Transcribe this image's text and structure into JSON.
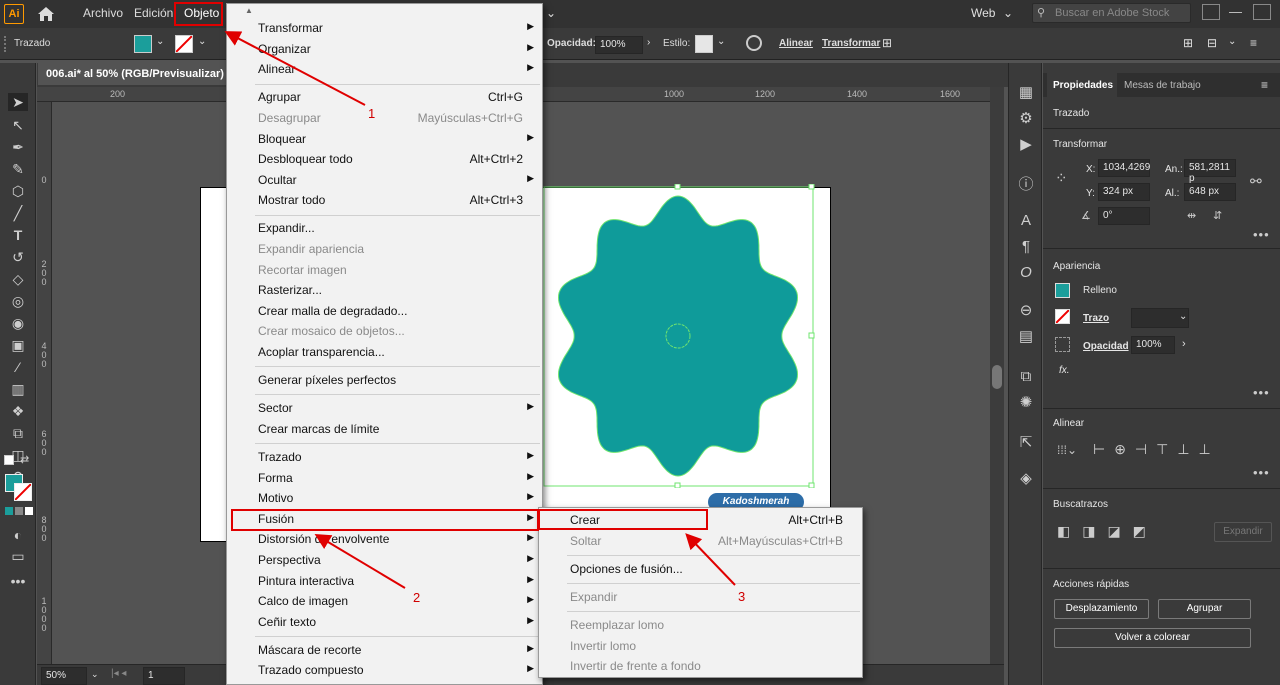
{
  "menubar": {
    "app_logo": "Ai",
    "menus": [
      "Archivo",
      "Edición",
      "Objeto"
    ],
    "workspace": "Web",
    "search_placeholder": "Buscar en Adobe Stock"
  },
  "control_bar": {
    "selection": "Trazado",
    "fill_color": "#1b9e9b",
    "opacity_label": "Opacidad:",
    "opacity_value": "100%",
    "style_label": "Estilo:",
    "align_label": "Alinear",
    "transform_label": "Transformar"
  },
  "document": {
    "tab_title": "006.ai* al 50% (RGB/Previsualizar)",
    "zoom": "50%",
    "artboard_nav": "1",
    "ruler_top": [
      "200",
      "1000",
      "1200",
      "1400",
      "1600"
    ],
    "ruler_left": [
      "0",
      "2 0 0",
      "4 0 0",
      "6 0 0",
      "8 0 0",
      "1 0 0 0"
    ],
    "shape_color": "#0f9b9a",
    "watermark_text": "Kadoshmerah"
  },
  "objeto_menu": {
    "items": [
      {
        "label": "Transformar",
        "submenu": true
      },
      {
        "label": "Organizar",
        "submenu": true
      },
      {
        "label": "Alinear",
        "submenu": true
      },
      {
        "sep": true
      },
      {
        "label": "Agrupar",
        "shortcut": "Ctrl+G"
      },
      {
        "label": "Desagrupar",
        "shortcut": "Mayúsculas+Ctrl+G",
        "disabled": true
      },
      {
        "label": "Bloquear",
        "submenu": true
      },
      {
        "label": "Desbloquear todo",
        "shortcut": "Alt+Ctrl+2"
      },
      {
        "label": "Ocultar",
        "submenu": true
      },
      {
        "label": "Mostrar todo",
        "shortcut": "Alt+Ctrl+3"
      },
      {
        "sep": true
      },
      {
        "label": "Expandir..."
      },
      {
        "label": "Expandir apariencia",
        "disabled": true
      },
      {
        "label": "Recortar imagen",
        "disabled": true
      },
      {
        "label": "Rasterizar..."
      },
      {
        "label": "Crear malla de degradado..."
      },
      {
        "label": "Crear mosaico de objetos...",
        "disabled": true
      },
      {
        "label": "Acoplar transparencia..."
      },
      {
        "sep": true
      },
      {
        "label": "Generar píxeles perfectos"
      },
      {
        "sep": true
      },
      {
        "label": "Sector",
        "submenu": true
      },
      {
        "label": "Crear marcas de límite"
      },
      {
        "sep": true
      },
      {
        "label": "Trazado",
        "submenu": true
      },
      {
        "label": "Forma",
        "submenu": true
      },
      {
        "label": "Motivo",
        "submenu": true
      },
      {
        "label": "Fusión",
        "submenu": true,
        "highlighted": true
      },
      {
        "label": "Distorsión de envolvente",
        "submenu": true
      },
      {
        "label": "Perspectiva",
        "submenu": true
      },
      {
        "label": "Pintura interactiva",
        "submenu": true
      },
      {
        "label": "Calco de imagen",
        "submenu": true
      },
      {
        "label": "Ceñir texto",
        "submenu": true
      },
      {
        "sep": true
      },
      {
        "label": "Máscara de recorte",
        "submenu": true
      },
      {
        "label": "Trazado compuesto",
        "submenu": true
      }
    ]
  },
  "fusion_submenu": {
    "items": [
      {
        "label": "Crear",
        "shortcut": "Alt+Ctrl+B",
        "highlighted": true
      },
      {
        "label": "Soltar",
        "shortcut": "Alt+Mayúsculas+Ctrl+B",
        "disabled": true
      },
      {
        "sep": true
      },
      {
        "label": "Opciones de fusión..."
      },
      {
        "sep": true
      },
      {
        "label": "Expandir",
        "disabled": true
      },
      {
        "sep": true
      },
      {
        "label": "Reemplazar lomo",
        "disabled": true
      },
      {
        "label": "Invertir lomo",
        "disabled": true
      },
      {
        "label": "Invertir de frente a fondo",
        "disabled": true
      }
    ]
  },
  "callouts": [
    "1",
    "2",
    "3"
  ],
  "properties_panel": {
    "tabs": [
      "Propiedades",
      "Mesas de trabajo"
    ],
    "selection": "Trazado",
    "transform_title": "Transformar",
    "x_label": "X:",
    "x_value": "1034,4269",
    "width_label": "An.:",
    "width_value": "581,2811 p",
    "y_label": "Y:",
    "y_value": "324 px",
    "height_label": "Al.:",
    "height_value": "648 px",
    "rotate_value": "0°",
    "appearance_title": "Apariencia",
    "fill_label": "Relleno",
    "stroke_label": "Trazo",
    "opacity_label": "Opacidad",
    "opacity_value": "100%",
    "fx_label": "fx.",
    "align_title": "Alinear",
    "pathfinder_title": "Buscatrazos",
    "expand_label": "Expandir",
    "quick_actions_title": "Acciones rápidas",
    "btn_offset": "Desplazamiento",
    "btn_group": "Agrupar",
    "btn_recolor": "Volver a colorear"
  }
}
